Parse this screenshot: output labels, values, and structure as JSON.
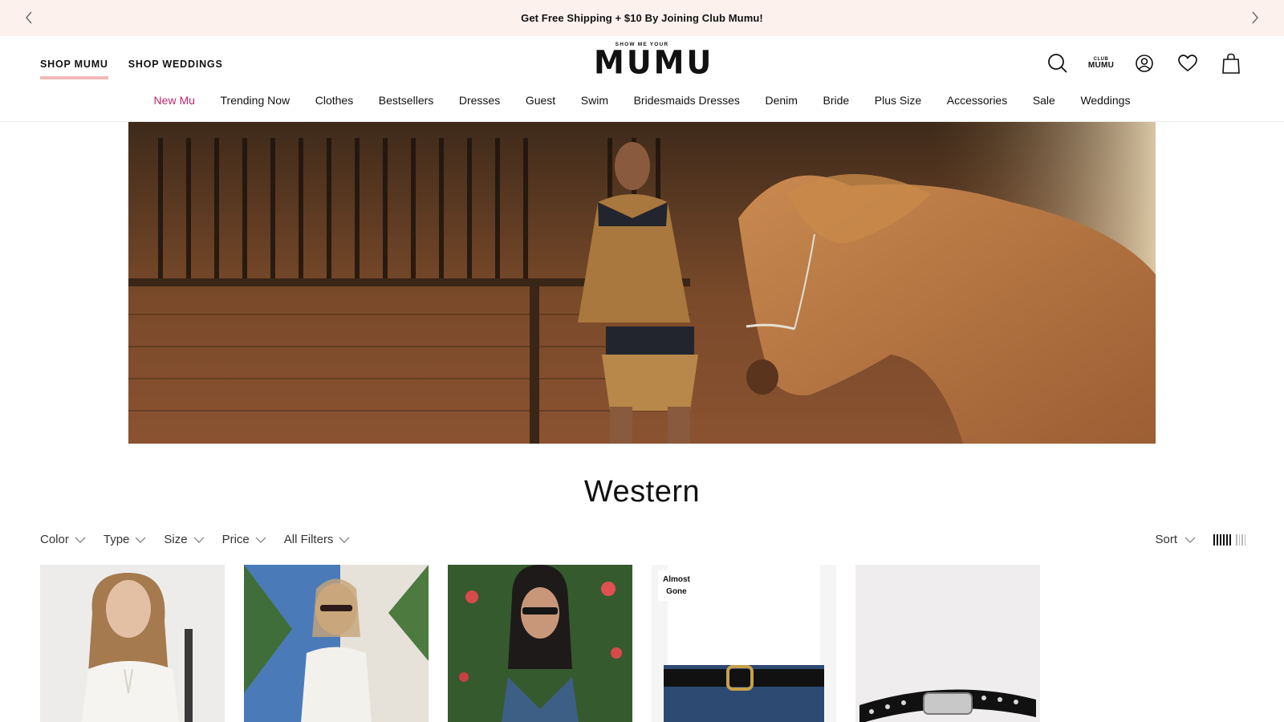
{
  "promo": {
    "text": "Get Free Shipping + $10 By Joining Club Mumu!",
    "prev_icon": "chevron-left-icon",
    "next_icon": "chevron-right-icon"
  },
  "header": {
    "shop_links": [
      {
        "label": "SHOP MUMU",
        "active": true
      },
      {
        "label": "SHOP WEDDINGS",
        "active": false
      }
    ],
    "logo": {
      "tagline": "SHOW ME YOUR",
      "wordmark": "MUMU"
    },
    "utility": {
      "search_icon": "search-icon",
      "club_small": "CLUB",
      "club_big": "MUMU",
      "account_icon": "account-icon",
      "wishlist_icon": "heart-icon",
      "bag_icon": "shopping-bag-icon"
    }
  },
  "nav": {
    "items": [
      "New Mu",
      "Trending Now",
      "Clothes",
      "Bestsellers",
      "Dresses",
      "Guest",
      "Swim",
      "Bridesmaids Dresses",
      "Denim",
      "Bride",
      "Plus Size",
      "Accessories",
      "Sale",
      "Weddings"
    ],
    "highlight_color": "#c0266d"
  },
  "page": {
    "title": "Western"
  },
  "filters": {
    "items": [
      "Color",
      "Type",
      "Size",
      "Price",
      "All Filters"
    ],
    "sort_label": "Sort"
  },
  "products": [
    {
      "badge": ""
    },
    {
      "badge": ""
    },
    {
      "badge": ""
    },
    {
      "badge_line1": "Almost",
      "badge_line2": "Gone"
    },
    {
      "badge": ""
    }
  ],
  "colors": {
    "promo_bg": "#fdf1ee",
    "active_underline": "#f0b9b8",
    "accent": "#c0266d"
  }
}
